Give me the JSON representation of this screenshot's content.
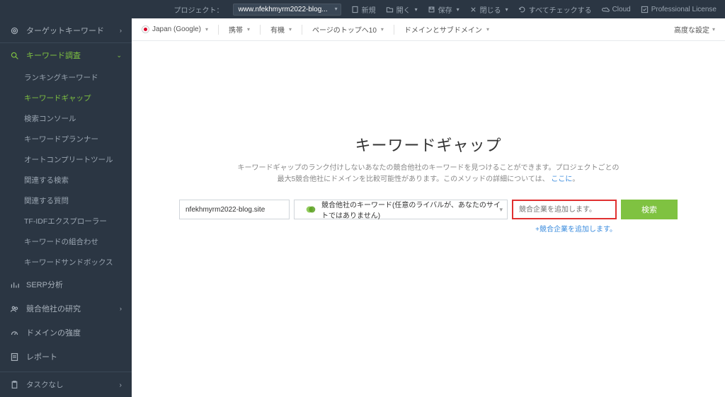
{
  "topbar": {
    "project_label": "プロジェクト：",
    "project_value": "www.nfekhmyrm2022-blog...",
    "new": "新規",
    "open": "開く",
    "save": "保存",
    "close": "閉じる",
    "checkall": "すべてチェックする",
    "cloud": "Cloud",
    "license": "Professional License"
  },
  "sidebar": {
    "target": "ターゲットキーワード",
    "research": "キーワード調査",
    "subs": {
      "ranking": "ランキングキーワード",
      "gap": "キーワードギャップ",
      "console": "検索コンソール",
      "planner": "キーワードプランナー",
      "autocomplete": "オートコンプリートツール",
      "related_search": "関連する検索",
      "related_question": "関連する質問",
      "tfidf": "TF-IDFエクスプローラー",
      "combine": "キーワードの組合わせ",
      "sandbox": "キーワードサンドボックス"
    },
    "serp": "SERP分析",
    "competitor": "競合他社の研究",
    "domain_strength": "ドメインの強度",
    "report": "レポート",
    "tasks": "タスクなし"
  },
  "filterbar": {
    "region": "Japan (Google)",
    "device": "携帯",
    "organic": "有機",
    "pagetop": "ページのトップへ10",
    "domain": "ドメインとサブドメイン",
    "advanced": "高度な設定"
  },
  "main": {
    "title": "キーワードギャップ",
    "desc1": "キーワードギャップのランク付けしないあなたの競合他社のキーワードを見つけることができます。プロジェクトごとの",
    "desc2": "最大5競合他社にドメインを比較可能性があります。このメソッドの詳細については、",
    "desc_link": "ここに",
    "desc_end": "。",
    "site_value": "nfekhmyrm2022-blog.site",
    "dd_label": "競合他社のキーワード(任意のライバルが、あなたのサイトではありません)",
    "comp_placeholder": "競合企業を追加します。",
    "search_btn": "検索",
    "add_more": "+競合企業を追加します。"
  }
}
